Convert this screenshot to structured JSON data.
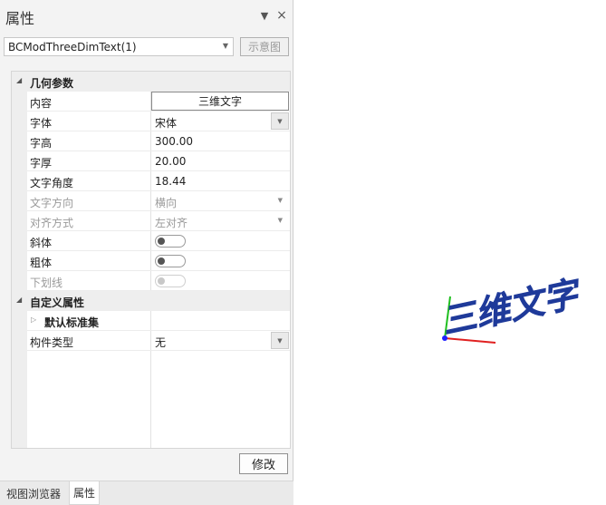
{
  "panel": {
    "title": "属性",
    "pin_icon": "▼",
    "close_icon": "×",
    "object_select": {
      "value": "BCModThreeDimText(1)"
    },
    "diagram_button": "示意图",
    "modify_button": "修改"
  },
  "grid": {
    "geometry_category": "几何参数",
    "content": {
      "name": "内容",
      "value": "三维文字"
    },
    "font": {
      "name": "字体",
      "value": "宋体"
    },
    "height": {
      "name": "字高",
      "value": "300.00"
    },
    "thickness": {
      "name": "字厚",
      "value": "20.00"
    },
    "angle": {
      "name": "文字角度",
      "value": "18.44"
    },
    "direction": {
      "name": "文字方向",
      "value": "横向"
    },
    "align": {
      "name": "对齐方式",
      "value": "左对齐"
    },
    "italic": {
      "name": "斜体",
      "on": false
    },
    "bold": {
      "name": "粗体",
      "on": false
    },
    "underline": {
      "name": "下划线",
      "on": false
    },
    "custom_category": "自定义属性",
    "default_standard_set": "默认标准集",
    "component_type": {
      "name": "构件类型",
      "value": "无"
    }
  },
  "tabs": [
    {
      "label": "视图浏览器",
      "active": false
    },
    {
      "label": "属性",
      "active": true
    }
  ],
  "viewport": {
    "text": "三维文字",
    "text_color": "#1f3a9a",
    "axis_x_color": "#e02020",
    "axis_y_color": "#1fbf1f",
    "axis_z_color": "#2020ff"
  }
}
